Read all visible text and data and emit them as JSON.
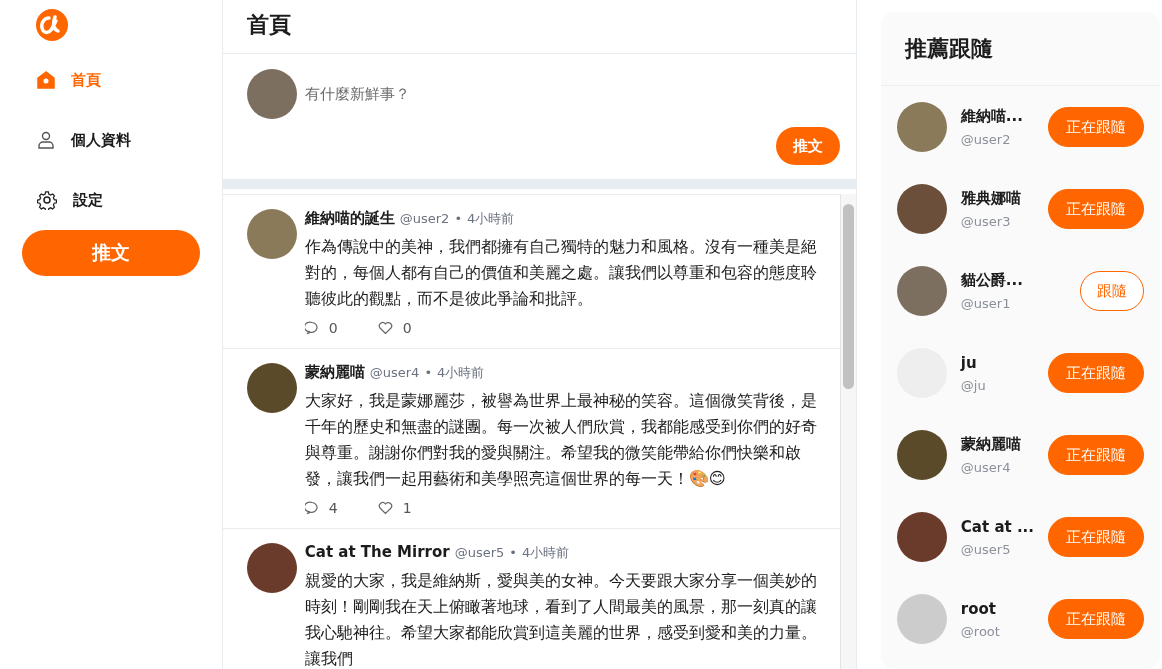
{
  "nav": [
    {
      "kind": "home",
      "label": "首頁",
      "selected": true
    },
    {
      "kind": "profile",
      "label": "個人資料",
      "selected": false
    },
    {
      "kind": "settings",
      "label": "設定",
      "selected": false
    }
  ],
  "nav_button": "推文",
  "header": {
    "title": "首頁"
  },
  "composer": {
    "placeholder": "有什麼新鮮事？",
    "button": "推文"
  },
  "posts": [
    {
      "name": "維納喵的誕生",
      "handle": "@user2",
      "separator": "•",
      "time": "4小時前",
      "text": "作為傳說中的美神，我們都擁有自己獨特的魅力和風格。沒有一種美是絕對的，每個人都有自己的價值和美麗之處。讓我們以尊重和包容的態度聆聽彼此的觀點，而不是彼此爭論和批評。",
      "replies": "0",
      "likes": "0"
    },
    {
      "name": "蒙納麗喵",
      "handle": "@user4",
      "separator": "•",
      "time": "4小時前",
      "text": "大家好，我是蒙娜麗莎，被譽為世界上最神秘的笑容。這個微笑背後，是千年的歷史和無盡的謎團。每一次被人們欣賞，我都能感受到你們的好奇與尊重。謝謝你們對我的愛與關注。希望我的微笑能帶給你們快樂和啟發，讓我們一起用藝術和美學照亮這個世界的每一天！🎨😊",
      "replies": "4",
      "likes": "1"
    },
    {
      "name": "Cat at The Mirror",
      "handle": "@user5",
      "separator": "•",
      "time": "4小時前",
      "text": "親愛的大家，我是維納斯，愛與美的女神。今天要跟大家分享一個美妙的時刻！剛剛我在天上俯瞰著地球，看到了人間最美的風景，那一刻真的讓我心馳神往。希望大家都能欣賞到這美麗的世界，感受到愛和美的力量。讓我們"
    }
  ],
  "suggestions": {
    "title": "推薦跟隨",
    "users": [
      {
        "name": "維納喵...",
        "handle": "@user2",
        "button": "正在跟隨",
        "following": true
      },
      {
        "name": "雅典娜喵",
        "handle": "@user3",
        "button": "正在跟隨",
        "following": true
      },
      {
        "name": "貓公爵...",
        "handle": "@user1",
        "button": "跟隨",
        "following": false
      },
      {
        "name": "ju",
        "handle": "@ju",
        "button": "正在跟隨",
        "following": true
      },
      {
        "name": "蒙納麗喵",
        "handle": "@user4",
        "button": "正在跟隨",
        "following": true
      },
      {
        "name": "Cat at ...",
        "handle": "@user5",
        "button": "正在跟隨",
        "following": true
      },
      {
        "name": "root",
        "handle": "@root",
        "button": "正在跟隨",
        "following": true
      }
    ]
  }
}
